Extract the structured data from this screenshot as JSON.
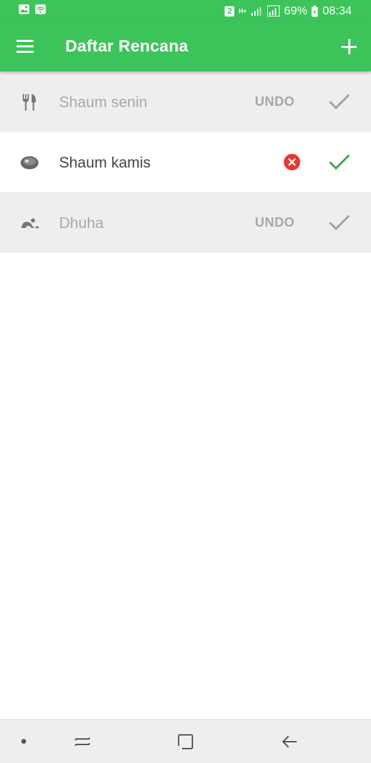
{
  "status_bar": {
    "sim_badge": "2",
    "network": "H+",
    "battery": "69%",
    "time": "08:34"
  },
  "toolbar": {
    "title": "Daftar Rencana"
  },
  "plans": [
    {
      "label": "Shaum senin",
      "state": "done",
      "action": "UNDO",
      "icon": "fork-knife-icon"
    },
    {
      "label": "Shaum kamis",
      "state": "active",
      "icon": "meat-icon"
    },
    {
      "label": "Dhuha",
      "state": "done",
      "action": "UNDO",
      "icon": "prayer-icon"
    }
  ],
  "colors": {
    "accent": "#3cc45a",
    "done_background": "#eeeeee",
    "check_active": "#43a047",
    "delete": "#e53935"
  }
}
